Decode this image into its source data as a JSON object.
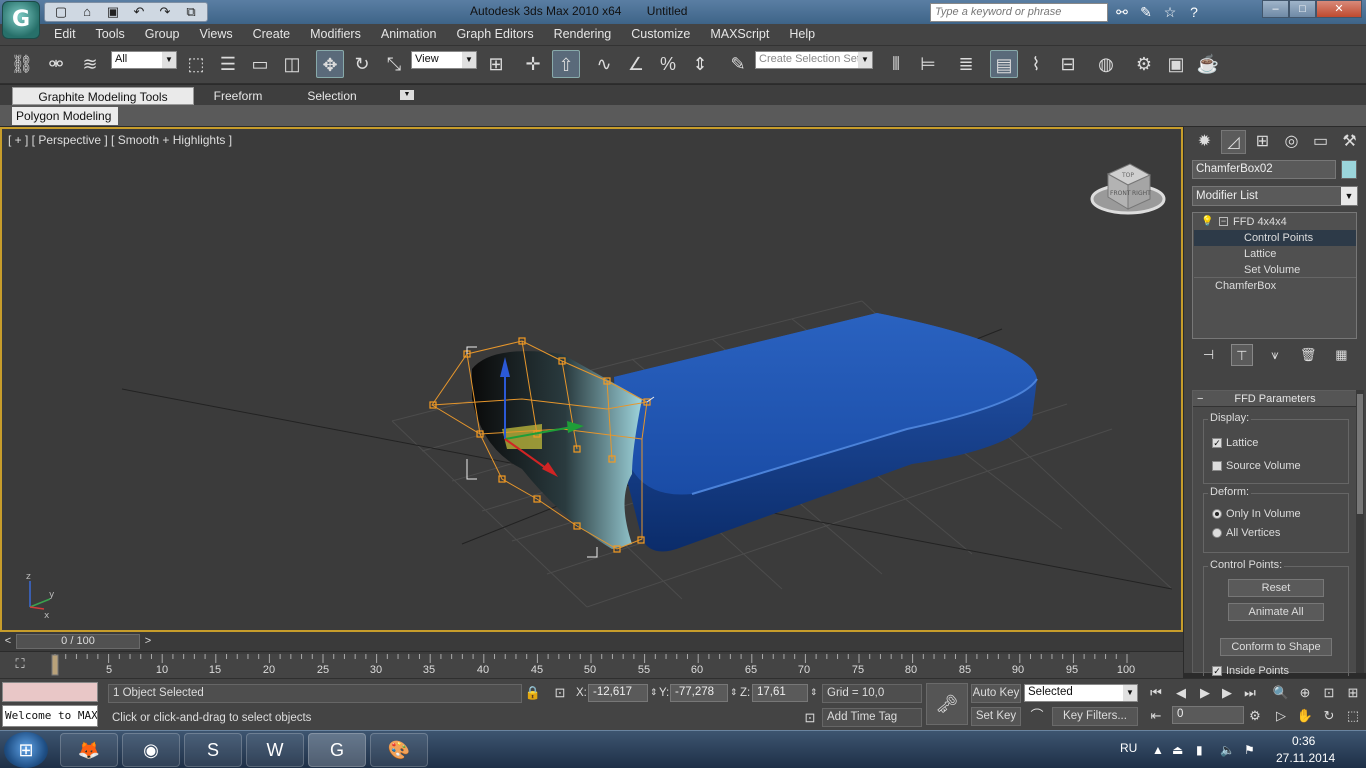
{
  "titlebar": {
    "app_logo": "G",
    "app_title": "Autodesk 3ds Max  2010 x64",
    "doc_title": "Untitled",
    "search_placeholder": "Type a keyword or phrase",
    "quick_access": [
      "new-icon",
      "open-icon",
      "save-icon",
      "undo-icon",
      "redo-icon",
      "project-icon"
    ],
    "info_icons": [
      "binoculars-icon",
      "tools-icon",
      "star-icon",
      "help-icon"
    ]
  },
  "menu": [
    "Edit",
    "Tools",
    "Group",
    "Views",
    "Create",
    "Modifiers",
    "Animation",
    "Graph Editors",
    "Rendering",
    "Customize",
    "MAXScript",
    "Help"
  ],
  "toolbar": {
    "filter_value": "All",
    "refcoord_value": "View",
    "selection_set_placeholder": "Create Selection Set"
  },
  "ribbon": {
    "tabs": [
      "Graphite Modeling Tools",
      "Freeform",
      "Selection"
    ],
    "panel": "Polygon Modeling"
  },
  "viewport": {
    "label": "[ + ] [ Perspective ] [ Smooth + Highlights ]",
    "viewcube_faces": [
      "TOP",
      "FRONT",
      "RIGHT"
    ],
    "axis_labels": [
      "z",
      "y",
      "x"
    ]
  },
  "command_panel": {
    "object_name": "ChamferBox02",
    "object_color": "#9bd6dc",
    "modifier_list": "Modifier List",
    "stack": [
      "FFD 4x4x4",
      "Control Points",
      "Lattice",
      "Set Volume",
      "ChamferBox"
    ],
    "stack_selected": "Control Points",
    "rollout_title": "FFD Parameters",
    "display_group": "Display:",
    "lattice_label": "Lattice",
    "lattice_checked": true,
    "source_volume_label": "Source Volume",
    "source_volume_checked": false,
    "deform_group": "Deform:",
    "only_in_volume_label": "Only In Volume",
    "all_vertices_label": "All Vertices",
    "deform_selected": "Only In Volume",
    "control_points_group": "Control Points:",
    "reset_label": "Reset",
    "animate_all_label": "Animate All",
    "conform_label": "Conform to Shape",
    "inside_points_label": "Inside Points"
  },
  "timeline": {
    "position": "0 / 100",
    "ticks": [
      "5",
      "10",
      "15",
      "20",
      "25",
      "30",
      "35",
      "40",
      "45",
      "50",
      "55",
      "60",
      "65",
      "70",
      "75",
      "80",
      "85",
      "90",
      "95",
      "100"
    ]
  },
  "status": {
    "listener_text": "Welcome to MAXScript.",
    "selection_info": "1 Object Selected",
    "prompt": "Click or click-and-drag to select objects",
    "x_label": "X:",
    "x_value": "-12,617",
    "y_label": "Y:",
    "y_value": "-77,278",
    "z_label": "Z:",
    "z_value": "17,61",
    "grid": "Grid = 10,0",
    "add_time_tag": "Add Time Tag",
    "auto_key": "Auto Key",
    "set_key": "Set Key",
    "key_mode": "Selected",
    "key_filters": "Key Filters...",
    "frame": "0"
  },
  "taskbar": {
    "apps": [
      "firefox-icon",
      "chrome-icon",
      "skype-icon",
      "word-icon",
      "3dsmax-icon",
      "paint-icon"
    ],
    "active_app": "3dsmax-icon",
    "language": "RU",
    "time": "0:36",
    "date": "27.11.2014"
  }
}
